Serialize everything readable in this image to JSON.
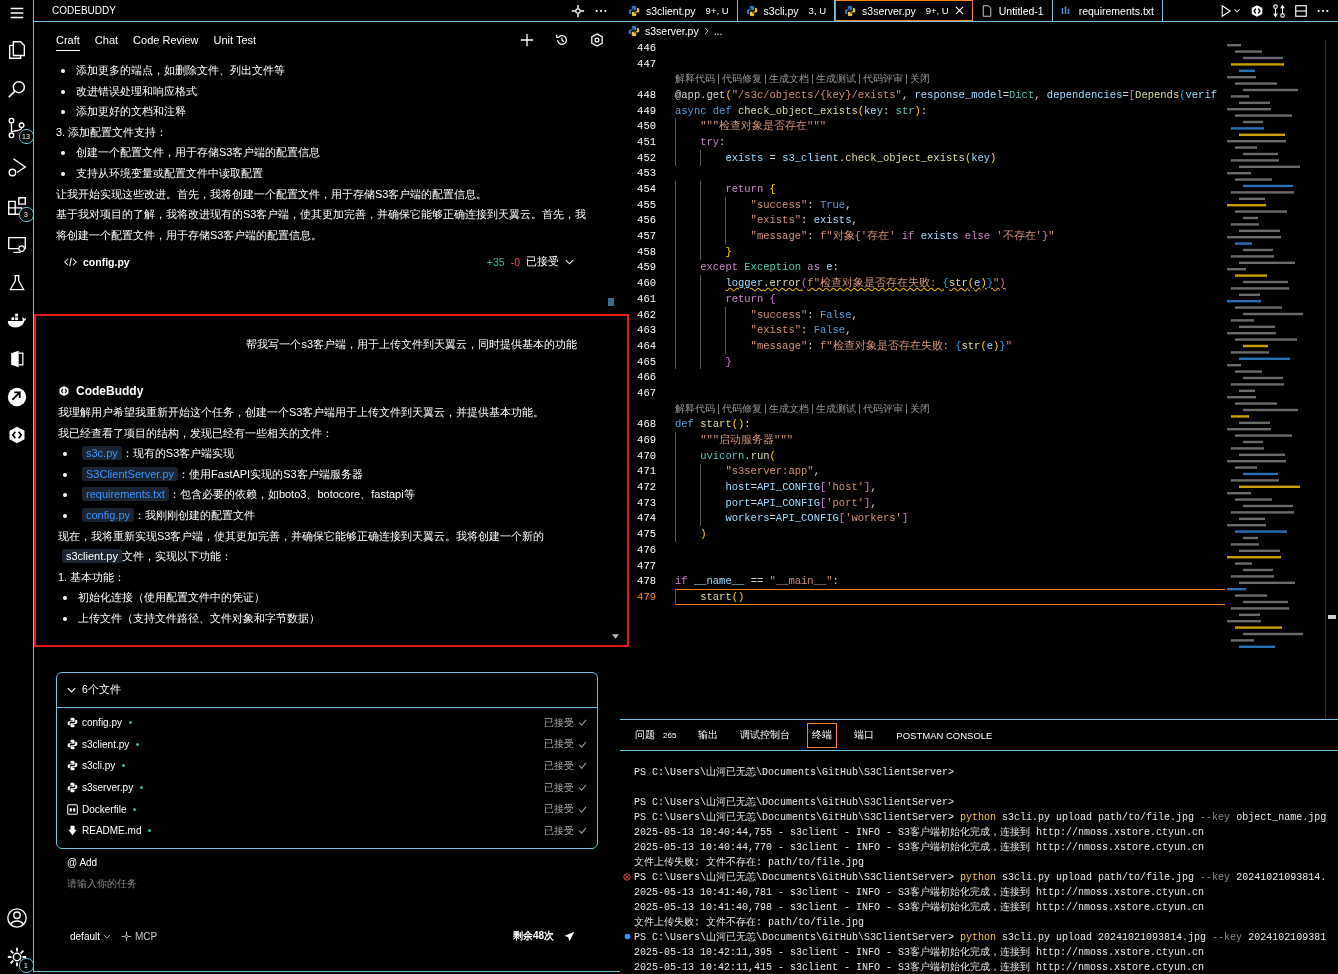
{
  "activity_bar": {
    "source_control_badge": "13",
    "extensions_badge": "3",
    "settings_badge": "1"
  },
  "side_panel": {
    "title": "CODEBUDDY",
    "tabs": [
      {
        "label": "Craft",
        "selected": true
      },
      {
        "label": "Chat",
        "selected": false
      },
      {
        "label": "Code Review",
        "selected": false
      },
      {
        "label": "Unit Test",
        "selected": false
      }
    ],
    "history": [
      {
        "kind": "bullet",
        "text": "添加更多的端点，如删除文件、列出文件等"
      },
      {
        "kind": "bullet",
        "text": "改进错误处理和响应格式"
      },
      {
        "kind": "bullet",
        "text": "添加更好的文档和注释"
      },
      {
        "kind": "para",
        "text": "3. 添加配置文件支持："
      },
      {
        "kind": "bullet",
        "text": "创建一个配置文件，用于存储S3客户端的配置信息"
      },
      {
        "kind": "bullet",
        "text": "支持从环境变量或配置文件中读取配置"
      },
      {
        "kind": "para",
        "text": "让我开始实现这些改进。首先，我将创建一个配置文件，用于存储S3客户端的配置信息。"
      },
      {
        "kind": "para",
        "text": "基于我对项目的了解，我将改进现有的S3客户端，使其更加完善，并确保它能够正确连接到天翼云。首先，我将创建一个配置文件，用于存储S3客户端的配置信息。"
      }
    ],
    "change": {
      "file": "config.py",
      "added": "+35",
      "removed": "-0",
      "status": "已接受"
    },
    "user_message": "帮我写一个s3客户端，用于上传文件到天翼云，同时提供基本的功能",
    "bot_name": "CodeBuddy",
    "reply": [
      {
        "kind": "para",
        "text": "我理解用户希望我重新开始这个任务，创建一个S3客户端用于上传文件到天翼云，并提供基本功能。"
      },
      {
        "kind": "para",
        "text": "我已经查看了项目的结构，发现已经有一些相关的文件："
      },
      {
        "kind": "bullet",
        "parts": [
          {
            "kind": "link",
            "text": "s3c.py"
          },
          {
            "kind": "text",
            "text": "：现有的S3客户端实现"
          }
        ]
      },
      {
        "kind": "bullet",
        "parts": [
          {
            "kind": "link",
            "text": "S3ClientServer.py"
          },
          {
            "kind": "text",
            "text": "：使用FastAPI实现的S3客户端服务器"
          }
        ]
      },
      {
        "kind": "bullet",
        "parts": [
          {
            "kind": "link",
            "text": "requirements.txt"
          },
          {
            "kind": "text",
            "text": "：包含必要的依赖，如boto3、botocore、fastapi等"
          }
        ]
      },
      {
        "kind": "bullet",
        "parts": [
          {
            "kind": "link",
            "text": "config.py"
          },
          {
            "kind": "text",
            "text": "：我刚刚创建的配置文件"
          }
        ]
      },
      {
        "kind": "para",
        "parts": [
          {
            "kind": "text",
            "text": "现在，我将重新实现S3客户端，使其更加完善，并确保它能够正确连接到天翼云。我将创建一个新的"
          },
          {
            "kind": "code",
            "text": "s3client.py"
          },
          {
            "kind": "text",
            "text": "文件，实现以下功能："
          }
        ]
      },
      {
        "kind": "para",
        "text": "1. 基本功能："
      },
      {
        "kind": "bullet",
        "text": "初始化连接（使用配置文件中的凭证）"
      },
      {
        "kind": "bullet",
        "text": "上传文件（支持文件路径、文件对象和字节数据）"
      }
    ],
    "files_card": {
      "title": "6个文件",
      "expanded": true,
      "files": [
        {
          "kind": "python",
          "name": "config.py",
          "status": "已接受"
        },
        {
          "kind": "python",
          "name": "s3client.py",
          "status": "已接受"
        },
        {
          "kind": "python",
          "name": "s3cli.py",
          "status": "已接受"
        },
        {
          "kind": "python",
          "name": "s3server.py",
          "status": "已接受"
        },
        {
          "kind": "docker",
          "name": "Dockerfile",
          "status": "已接受"
        },
        {
          "kind": "markdown",
          "name": "README.md",
          "status": "已接受"
        }
      ]
    },
    "add_label": "@ Add",
    "input": {
      "placeholder": "请输入你的任务"
    },
    "mode": "default",
    "mcp": "MCP",
    "remaining": "剩余48次"
  },
  "editor": {
    "tabs": [
      {
        "kind": "python",
        "label": "s3client.py",
        "badge": "9+, U",
        "selected": false
      },
      {
        "kind": "python",
        "label": "s3cli.py",
        "badge": "3, U",
        "selected": false
      },
      {
        "kind": "python",
        "label": "s3server.py",
        "badge": "9+, U",
        "selected": true
      },
      {
        "kind": "file",
        "label": "Untitled-1",
        "selected": false
      },
      {
        "kind": "text",
        "label": "requirements.txt",
        "selected": false
      }
    ],
    "breadcrumb": [
      "s3server.py",
      "..."
    ],
    "lines": [
      {
        "kind": "code",
        "num": "446"
      },
      {
        "kind": "code",
        "num": "447"
      },
      {
        "kind": "lens",
        "actions": [
          "解释代码",
          "代码修复",
          "生成文档",
          "生成测试",
          "代码评审",
          "关闭"
        ]
      },
      {
        "kind": "code",
        "num": "448",
        "current": false,
        "warning": false,
        "tokens": [
          {
            "text": "@app.get",
            "kind": "plain"
          },
          {
            "text": "(",
            "kind": "br"
          },
          {
            "text": "\"/s3c/objects/{key}/exists\"",
            "kind": "str"
          },
          {
            "text": ", ",
            "kind": "plain"
          },
          {
            "text": "response_model",
            "kind": "var"
          },
          {
            "text": "=",
            "kind": "plain"
          },
          {
            "text": "Dict",
            "kind": "cls"
          },
          {
            "text": ", ",
            "kind": "plain"
          },
          {
            "text": "dependencies",
            "kind": "var"
          },
          {
            "text": "=",
            "kind": "plain"
          },
          {
            "text": "[",
            "kind": "br2"
          },
          {
            "text": "Depends",
            "kind": "fn"
          },
          {
            "text": "(",
            "kind": "br3"
          },
          {
            "text": "verif",
            "kind": "var"
          }
        ]
      },
      {
        "kind": "code",
        "num": "449",
        "current": false,
        "warning": false,
        "tokens": [
          {
            "text": "async def ",
            "kind": "kw"
          },
          {
            "text": "check_object_exists",
            "kind": "fn"
          },
          {
            "text": "(",
            "kind": "br"
          },
          {
            "text": "key",
            "kind": "var"
          },
          {
            "text": ": ",
            "kind": "plain"
          },
          {
            "text": "str",
            "kind": "cls"
          },
          {
            "text": ")",
            "kind": "br"
          },
          {
            "text": ":",
            "kind": "plain"
          }
        ],
        "children": [
          {
            "kind": "code",
            "num": "450",
            "current": false,
            "warning": false,
            "tokens": [
              {
                "text": "\"\"\"检查对象是否存在\"\"\"",
                "kind": "str"
              }
            ]
          },
          {
            "kind": "code",
            "num": "451",
            "current": false,
            "warning": false,
            "tokens": [
              {
                "text": "try",
                "kind": "ctl"
              },
              {
                "text": ":",
                "kind": "plain"
              }
            ],
            "children": [
              {
                "kind": "code",
                "num": "452",
                "current": false,
                "warning": false,
                "tokens": [
                  {
                    "text": "exists",
                    "kind": "var"
                  },
                  {
                    "text": " = ",
                    "kind": "plain"
                  },
                  {
                    "text": "s3_client",
                    "kind": "var"
                  },
                  {
                    "text": ".",
                    "kind": "plain"
                  },
                  {
                    "text": "check_object_exists",
                    "kind": "fn"
                  },
                  {
                    "text": "(",
                    "kind": "br"
                  },
                  {
                    "text": "key",
                    "kind": "var"
                  },
                  {
                    "text": ")",
                    "kind": "br"
                  }
                ]
              },
              {
                "kind": "code",
                "num": "453"
              },
              {
                "kind": "code",
                "num": "454",
                "current": false,
                "warning": false,
                "tokens": [
                  {
                    "text": "return ",
                    "kind": "ctl"
                  },
                  {
                    "text": "{",
                    "kind": "br"
                  }
                ],
                "children": [
                  {
                    "kind": "code",
                    "num": "455",
                    "current": false,
                    "warning": false,
                    "tokens": [
                      {
                        "text": "\"success\"",
                        "kind": "str"
                      },
                      {
                        "text": ": ",
                        "kind": "plain"
                      },
                      {
                        "text": "True",
                        "kind": "kw"
                      },
                      {
                        "text": ",",
                        "kind": "plain"
                      }
                    ]
                  },
                  {
                    "kind": "code",
                    "num": "456",
                    "current": false,
                    "warning": false,
                    "tokens": [
                      {
                        "text": "\"exists\"",
                        "kind": "str"
                      },
                      {
                        "text": ": ",
                        "kind": "plain"
                      },
                      {
                        "text": "exists",
                        "kind": "var"
                      },
                      {
                        "text": ",",
                        "kind": "plain"
                      }
                    ]
                  },
                  {
                    "kind": "code",
                    "num": "457",
                    "current": false,
                    "warning": false,
                    "tokens": [
                      {
                        "text": "\"message\"",
                        "kind": "str"
                      },
                      {
                        "text": ": ",
                        "kind": "plain"
                      },
                      {
                        "text": "f\"对象",
                        "kind": "str"
                      },
                      {
                        "text": "{",
                        "kind": "br2"
                      },
                      {
                        "text": "'存在'",
                        "kind": "str"
                      },
                      {
                        "text": " if ",
                        "kind": "ctl"
                      },
                      {
                        "text": "exists",
                        "kind": "var"
                      },
                      {
                        "text": " else ",
                        "kind": "ctl"
                      },
                      {
                        "text": "'不存在'",
                        "kind": "str"
                      },
                      {
                        "text": "}",
                        "kind": "br2"
                      },
                      {
                        "text": "\"",
                        "kind": "str"
                      }
                    ]
                  }
                ]
              },
              {
                "kind": "code",
                "num": "458",
                "current": false,
                "warning": false,
                "tokens": [
                  {
                    "text": "}",
                    "kind": "br"
                  }
                ]
              }
            ]
          },
          {
            "kind": "code",
            "num": "459",
            "current": false,
            "warning": false,
            "tokens": [
              {
                "text": "except ",
                "kind": "ctl"
              },
              {
                "text": "Exception",
                "kind": "cls"
              },
              {
                "text": " as ",
                "kind": "ctl"
              },
              {
                "text": "e",
                "kind": "var"
              },
              {
                "text": ":",
                "kind": "plain"
              }
            ],
            "children": [
              {
                "kind": "code",
                "num": "460",
                "current": false,
                "warning": true,
                "tokens": [
                  {
                    "text": "logger",
                    "kind": "var"
                  },
                  {
                    "text": ".",
                    "kind": "plain"
                  },
                  {
                    "text": "error",
                    "kind": "fn"
                  },
                  {
                    "text": "(",
                    "kind": "br2"
                  },
                  {
                    "text": "f\"检查对象是否存在失败: ",
                    "kind": "str"
                  },
                  {
                    "text": "{",
                    "kind": "br3"
                  },
                  {
                    "text": "str",
                    "kind": "fn"
                  },
                  {
                    "text": "(",
                    "kind": "br"
                  },
                  {
                    "text": "e",
                    "kind": "var"
                  },
                  {
                    "text": ")",
                    "kind": "br"
                  },
                  {
                    "text": "}",
                    "kind": "br3"
                  },
                  {
                    "text": "\"",
                    "kind": "str"
                  },
                  {
                    "text": ")",
                    "kind": "br2"
                  }
                ]
              },
              {
                "kind": "code",
                "num": "461",
                "current": false,
                "warning": false,
                "tokens": [
                  {
                    "text": "return ",
                    "kind": "ctl"
                  },
                  {
                    "text": "{",
                    "kind": "br2"
                  }
                ],
                "children": [
                  {
                    "kind": "code",
                    "num": "462",
                    "current": false,
                    "warning": false,
                    "tokens": [
                      {
                        "text": "\"success\"",
                        "kind": "str"
                      },
                      {
                        "text": ": ",
                        "kind": "plain"
                      },
                      {
                        "text": "False",
                        "kind": "kw"
                      },
                      {
                        "text": ",",
                        "kind": "plain"
                      }
                    ]
                  },
                  {
                    "kind": "code",
                    "num": "463",
                    "current": false,
                    "warning": false,
                    "tokens": [
                      {
                        "text": "\"exists\"",
                        "kind": "str"
                      },
                      {
                        "text": ": ",
                        "kind": "plain"
                      },
                      {
                        "text": "False",
                        "kind": "kw"
                      },
                      {
                        "text": ",",
                        "kind": "plain"
                      }
                    ]
                  },
                  {
                    "kind": "code",
                    "num": "464",
                    "current": false,
                    "warning": false,
                    "tokens": [
                      {
                        "text": "\"message\"",
                        "kind": "str"
                      },
                      {
                        "text": ": ",
                        "kind": "plain"
                      },
                      {
                        "text": "f\"检查对象是否存在失败: ",
                        "kind": "str"
                      },
                      {
                        "text": "{",
                        "kind": "br3"
                      },
                      {
                        "text": "str",
                        "kind": "fn"
                      },
                      {
                        "text": "(",
                        "kind": "br"
                      },
                      {
                        "text": "e",
                        "kind": "var"
                      },
                      {
                        "text": ")",
                        "kind": "br"
                      },
                      {
                        "text": "}",
                        "kind": "br3"
                      },
                      {
                        "text": "\"",
                        "kind": "str"
                      }
                    ]
                  }
                ]
              },
              {
                "kind": "code",
                "num": "465",
                "current": false,
                "warning": false,
                "tokens": [
                  {
                    "text": "}",
                    "kind": "br2"
                  }
                ]
              }
            ]
          }
        ]
      },
      {
        "kind": "code",
        "num": "466"
      },
      {
        "kind": "code",
        "num": "467"
      },
      {
        "kind": "lens",
        "actions": [
          "解释代码",
          "代码修复",
          "生成文档",
          "生成测试",
          "代码评审",
          "关闭"
        ]
      },
      {
        "kind": "code",
        "num": "468",
        "current": false,
        "warning": false,
        "tokens": [
          {
            "text": "def ",
            "kind": "kw"
          },
          {
            "text": "start",
            "kind": "fn"
          },
          {
            "text": "()",
            "kind": "br"
          },
          {
            "text": ":",
            "kind": "plain"
          }
        ],
        "children": [
          {
            "kind": "code",
            "num": "469",
            "current": false,
            "warning": false,
            "tokens": [
              {
                "text": "\"\"\"启动服务器\"\"\"",
                "kind": "str"
              }
            ]
          },
          {
            "kind": "code",
            "num": "470",
            "current": false,
            "warning": false,
            "tokens": [
              {
                "text": "uvicorn",
                "kind": "cls"
              },
              {
                "text": ".",
                "kind": "plain"
              },
              {
                "text": "run",
                "kind": "fn"
              },
              {
                "text": "(",
                "kind": "br"
              }
            ],
            "children": [
              {
                "kind": "code",
                "num": "471",
                "current": false,
                "warning": false,
                "tokens": [
                  {
                    "text": "\"s3server:app\"",
                    "kind": "str"
                  },
                  {
                    "text": ",",
                    "kind": "plain"
                  }
                ]
              },
              {
                "kind": "code",
                "num": "472",
                "current": false,
                "warning": false,
                "tokens": [
                  {
                    "text": "host",
                    "kind": "var"
                  },
                  {
                    "text": "=",
                    "kind": "plain"
                  },
                  {
                    "text": "API_CONFIG",
                    "kind": "var"
                  },
                  {
                    "text": "[",
                    "kind": "br2"
                  },
                  {
                    "text": "'host'",
                    "kind": "str"
                  },
                  {
                    "text": "]",
                    "kind": "br2"
                  },
                  {
                    "text": ",",
                    "kind": "plain"
                  }
                ]
              },
              {
                "kind": "code",
                "num": "473",
                "current": false,
                "warning": false,
                "tokens": [
                  {
                    "text": "port",
                    "kind": "var"
                  },
                  {
                    "text": "=",
                    "kind": "plain"
                  },
                  {
                    "text": "API_CONFIG",
                    "kind": "var"
                  },
                  {
                    "text": "[",
                    "kind": "br2"
                  },
                  {
                    "text": "'port'",
                    "kind": "str"
                  },
                  {
                    "text": "]",
                    "kind": "br2"
                  },
                  {
                    "text": ",",
                    "kind": "plain"
                  }
                ]
              },
              {
                "kind": "code",
                "num": "474",
                "current": false,
                "warning": false,
                "tokens": [
                  {
                    "text": "workers",
                    "kind": "var"
                  },
                  {
                    "text": "=",
                    "kind": "plain"
                  },
                  {
                    "text": "API_CONFIG",
                    "kind": "var"
                  },
                  {
                    "text": "[",
                    "kind": "br2"
                  },
                  {
                    "text": "'workers'",
                    "kind": "str"
                  },
                  {
                    "text": "]",
                    "kind": "br2"
                  }
                ]
              }
            ]
          },
          {
            "kind": "code",
            "num": "475",
            "current": false,
            "warning": false,
            "tokens": [
              {
                "text": ")",
                "kind": "br"
              }
            ]
          }
        ]
      },
      {
        "kind": "code",
        "num": "476"
      },
      {
        "kind": "code",
        "num": "477"
      },
      {
        "kind": "code",
        "num": "478",
        "current": false,
        "warning": false,
        "tokens": [
          {
            "text": "if ",
            "kind": "ctl"
          },
          {
            "text": "__name__",
            "kind": "var"
          },
          {
            "text": " == ",
            "kind": "plain"
          },
          {
            "text": "\"__main__\"",
            "kind": "str"
          },
          {
            "text": ":",
            "kind": "plain"
          }
        ],
        "children": [
          {
            "kind": "code",
            "num": "479",
            "current": true,
            "warning": false,
            "tokens": [
              {
                "text": "start",
                "kind": "fn"
              },
              {
                "text": "()",
                "kind": "br"
              }
            ]
          }
        ]
      }
    ]
  },
  "panel": {
    "tabs": [
      {
        "label": "问题",
        "badge": "265",
        "selected": false
      },
      {
        "label": "输出",
        "selected": false
      },
      {
        "label": "调试控制台",
        "selected": false
      },
      {
        "label": "终端",
        "selected": true
      },
      {
        "label": "端口",
        "selected": false
      },
      {
        "label": "POSTMAN CONSOLE",
        "selected": false
      }
    ],
    "terminal": [
      {
        "kind": "plain",
        "tokens": [
          {
            "text": "PS C:\\Users\\山河已无恙\\Documents\\GitHub\\S3ClientServer>",
            "kind": "plain"
          }
        ]
      },
      {
        "kind": "plain",
        "spaced": true,
        "tokens": [
          {
            "text": "PS C:\\Users\\山河已无恙\\Documents\\GitHub\\S3ClientServer>",
            "kind": "plain"
          }
        ]
      },
      {
        "kind": "plain",
        "tokens": [
          {
            "text": "PS C:\\Users\\山河已无恙\\Documents\\GitHub\\S3ClientServer> ",
            "kind": "plain"
          },
          {
            "text": "python",
            "kind": "cmd"
          },
          {
            "text": " s3cli.py upload path/to/file.jpg ",
            "kind": "plain"
          },
          {
            "text": "--key",
            "kind": "flag"
          },
          {
            "text": " object_name.jpg",
            "kind": "plain"
          }
        ]
      },
      {
        "kind": "plain",
        "tokens": [
          {
            "text": "2025-05-13 10:40:44,755 - s3client - INFO - S3客户端初始化完成，连接到 http://nmoss.xstore.ctyun.cn",
            "kind": "plain"
          }
        ]
      },
      {
        "kind": "plain",
        "tokens": [
          {
            "text": "2025-05-13 10:40:44,770 - s3client - INFO - S3客户端初始化完成，连接到 http://nmoss.xstore.ctyun.cn",
            "kind": "plain"
          }
        ]
      },
      {
        "kind": "plain",
        "tokens": [
          {
            "text": "文件上传失败: 文件不存在: path/to/file.jpg",
            "kind": "plain"
          }
        ]
      },
      {
        "kind": "error",
        "tokens": [
          {
            "text": "PS C:\\Users\\山河已无恙\\Documents\\GitHub\\S3ClientServer> ",
            "kind": "plain"
          },
          {
            "text": "python",
            "kind": "cmd"
          },
          {
            "text": " s3cli.py upload path/to/file.jpg ",
            "kind": "plain"
          },
          {
            "text": "--key",
            "kind": "flag"
          },
          {
            "text": " 20241021093814.",
            "kind": "plain"
          }
        ]
      },
      {
        "kind": "plain",
        "tokens": [
          {
            "text": "2025-05-13 10:41:40,781 - s3client - INFO - S3客户端初始化完成，连接到 http://nmoss.xstore.ctyun.cn",
            "kind": "plain"
          }
        ]
      },
      {
        "kind": "plain",
        "tokens": [
          {
            "text": "2025-05-13 10:41:40,798 - s3client - INFO - S3客户端初始化完成，连接到 http://nmoss.xstore.ctyun.cn",
            "kind": "plain"
          }
        ]
      },
      {
        "kind": "plain",
        "tokens": [
          {
            "text": "文件上传失败: 文件不存在: path/to/file.jpg",
            "kind": "plain"
          }
        ]
      },
      {
        "kind": "info",
        "tokens": [
          {
            "text": "PS C:\\Users\\山河已无恙\\Documents\\GitHub\\S3ClientServer> ",
            "kind": "plain"
          },
          {
            "text": "python",
            "kind": "cmd"
          },
          {
            "text": " s3cli.py upload 20241021093814.jpg ",
            "kind": "plain"
          },
          {
            "text": "--key",
            "kind": "flag"
          },
          {
            "text": " 2024102109381",
            "kind": "plain"
          }
        ]
      },
      {
        "kind": "plain",
        "tokens": [
          {
            "text": "2025-05-13 10:42:11,395 - s3client - INFO - S3客户端初始化完成，连接到 http://nmoss.xstore.ctyun.cn",
            "kind": "plain"
          }
        ]
      },
      {
        "kind": "plain",
        "tokens": [
          {
            "text": "2025-05-13 10:42:11,415 - s3client - INFO - S3客户端初始化完成，连接到 http://nmoss.xstore.ctyun.cn",
            "kind": "plain"
          }
        ]
      }
    ]
  }
}
